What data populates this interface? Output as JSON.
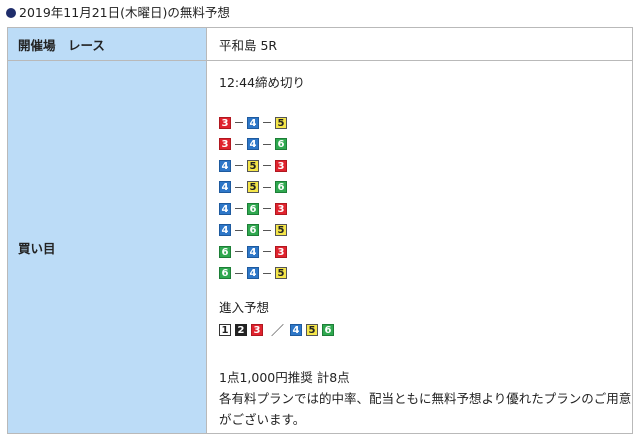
{
  "heading": "2019年11月21日(木曜日)の無料予想",
  "table": {
    "row1": {
      "label": "開催場　レース",
      "value": "平和島 5R"
    },
    "row2": {
      "label": "買い目",
      "deadline": "12:44締め切り",
      "combos": [
        [
          "3",
          "4",
          "5"
        ],
        [
          "3",
          "4",
          "6"
        ],
        [
          "4",
          "5",
          "3"
        ],
        [
          "4",
          "5",
          "6"
        ],
        [
          "4",
          "6",
          "3"
        ],
        [
          "4",
          "6",
          "5"
        ],
        [
          "6",
          "4",
          "3"
        ],
        [
          "6",
          "4",
          "5"
        ]
      ],
      "entry_title": "進入予想",
      "entry_inner": [
        "1",
        "2",
        "3"
      ],
      "entry_slash": "／",
      "entry_outer": [
        "4",
        "5",
        "6"
      ],
      "recommendation": "1点1,000円推奨 計8点",
      "note": "各有料プランでは的中率、配当ともに無料予想より優れたプランのご用意がございます。"
    }
  },
  "colors": {
    "label_bg": "#bcdcf7",
    "dot": "#1f2d6b",
    "boat_1": "#ffffff",
    "boat_2": "#222222",
    "boat_3": "#e0232e",
    "boat_4": "#2e77c8",
    "boat_5": "#f5e64a",
    "boat_6": "#2fa84f"
  }
}
